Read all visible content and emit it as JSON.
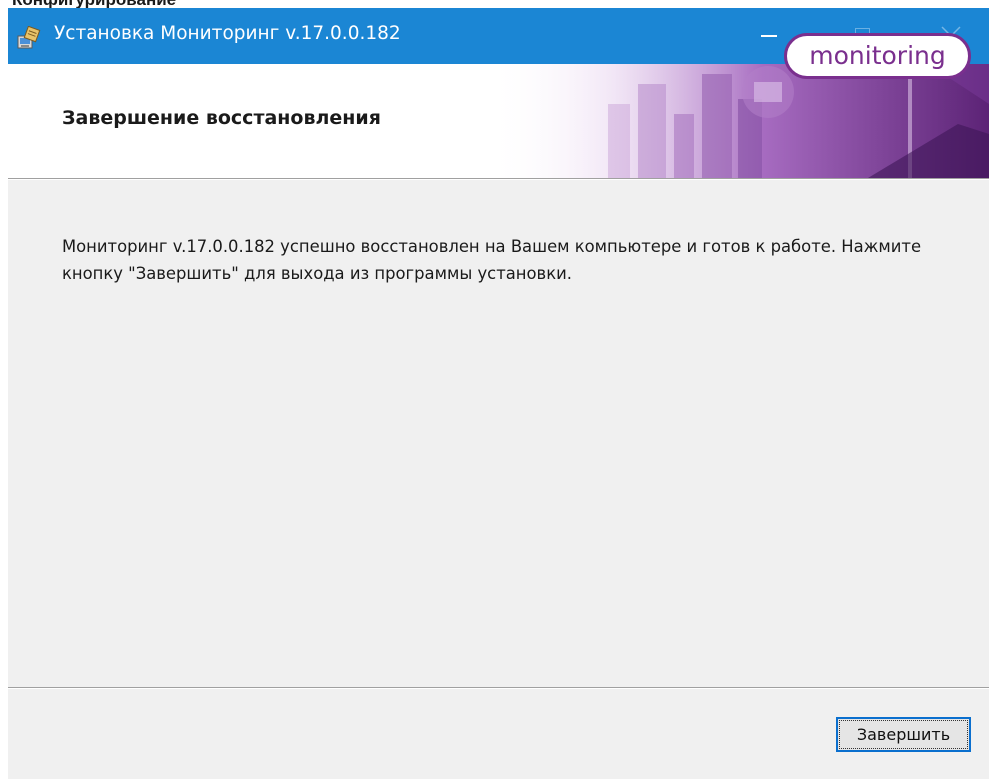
{
  "above_window": {
    "cropped_text": "Конфигурирование"
  },
  "window": {
    "title": "Установка Мониторинг v.17.0.0.182",
    "icon": "installer-package-icon",
    "controls": {
      "minimize": "minimize-icon",
      "maximize": "maximize-icon",
      "close": "close-icon"
    },
    "titlebar_color": "#1b86d4"
  },
  "header": {
    "title": "Завершение восстановления",
    "logo_text": "monitoring",
    "brand_color": "#7a2f8e"
  },
  "main": {
    "message": "Мониторинг v.17.0.0.182 успешно восстановлен на Вашем компьютере и готов к работе. Нажмите кнопку \"Завершить\" для выхода из программы установки."
  },
  "footer": {
    "finish_label": "Завершить"
  }
}
